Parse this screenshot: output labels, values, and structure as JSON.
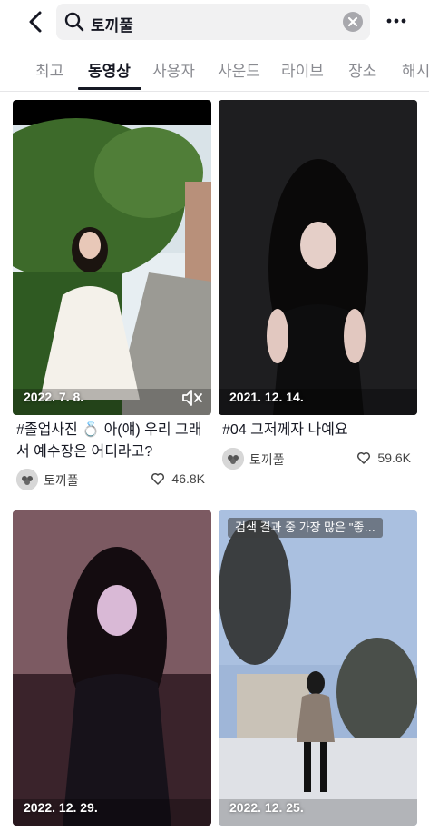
{
  "search": {
    "query": "토끼풀"
  },
  "tabs": [
    "최고",
    "동영상",
    "사용자",
    "사운드",
    "라이브",
    "장소",
    "해시"
  ],
  "active_tab": "동영상",
  "videos": [
    {
      "date": "2022. 7. 8.",
      "caption": "#졸업사진 💍 아(얘) 우리 그래서 예수장은 어디라고?",
      "author": "토끼풀",
      "likes": "46.8K",
      "muted": true
    },
    {
      "date": "2021. 12. 14.",
      "caption": "#04 그저께자 나예요",
      "author": "토끼풀",
      "likes": "59.6K"
    },
    {
      "date": "2022. 12. 29."
    },
    {
      "date": "2022. 12. 25.",
      "overlay": "검색 결과 중 가장 많은 \"좋…"
    }
  ]
}
